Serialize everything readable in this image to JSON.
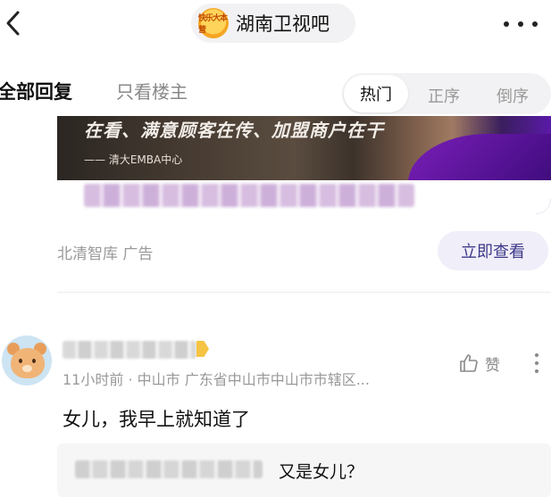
{
  "header": {
    "forum_name": "湖南卫视吧",
    "forum_logo_text": "快乐大本营",
    "back_icon": "chevron-left-icon",
    "more_icon": "more-horizontal-icon"
  },
  "tabs": {
    "all_replies": "全部回复",
    "only_op": "只看楼主"
  },
  "sort": {
    "hot": "热门",
    "ascending": "正序",
    "descending": "倒序"
  },
  "ad": {
    "slogan": "在看、满意顾客在传、加盟商户在干",
    "source": "—— 清大EMBA中心",
    "advertiser": "北清智库  广告",
    "cta": "立即查看",
    "accent_color": "#5a1aa8"
  },
  "comment": {
    "meta": "11小时前 · 中山市 广东省中山市中山市市辖区...",
    "text": "女儿，我早上就知道了",
    "like_label": "赞",
    "like_icon": "thumbs-up-icon",
    "more_icon": "more-vertical-icon",
    "reply": {
      "text": "又是女儿？"
    }
  }
}
